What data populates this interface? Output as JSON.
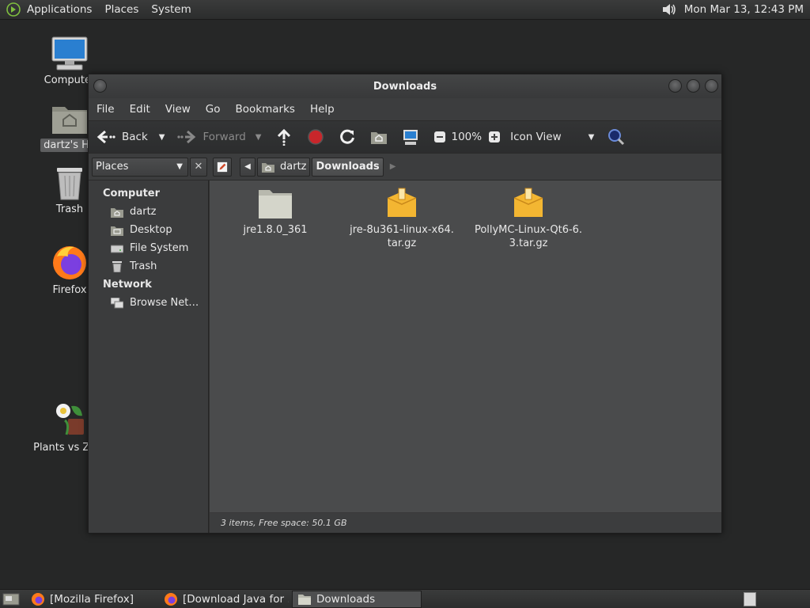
{
  "top_panel": {
    "menus": [
      "Applications",
      "Places",
      "System"
    ],
    "clock": "Mon Mar 13, 12:43 PM"
  },
  "desktop": {
    "icons": [
      {
        "label": "Computer",
        "icon": "computer-icon"
      },
      {
        "label": "dartz's Ho",
        "icon": "home-folder-icon"
      },
      {
        "label": "Trash",
        "icon": "trash-icon"
      },
      {
        "label": "Firefox",
        "icon": "firefox-icon"
      },
      {
        "label": "Plants vs Zom",
        "icon": "plants-vs-zombies-icon"
      }
    ]
  },
  "window": {
    "title": "Downloads",
    "menu": [
      "File",
      "Edit",
      "View",
      "Go",
      "Bookmarks",
      "Help"
    ],
    "toolbar": {
      "back": "Back",
      "forward": "Forward",
      "zoom": "100%",
      "view_mode": "Icon View"
    },
    "location": {
      "places_label": "Places",
      "crumbs": [
        "dartz",
        "Downloads"
      ]
    },
    "sidebar": {
      "sections": [
        {
          "heading": "Computer",
          "items": [
            {
              "label": "dartz",
              "icon": "home-icon"
            },
            {
              "label": "Desktop",
              "icon": "desktop-icon"
            },
            {
              "label": "File System",
              "icon": "drive-icon"
            },
            {
              "label": "Trash",
              "icon": "trash-icon"
            }
          ]
        },
        {
          "heading": "Network",
          "items": [
            {
              "label": "Browse Net…",
              "icon": "network-icon"
            }
          ]
        }
      ]
    },
    "files": [
      {
        "line1": "jre1.8.0_361",
        "line2": "",
        "type": "folder"
      },
      {
        "line1": "jre-8u361-linux-x64.",
        "line2": "tar.gz",
        "type": "archive"
      },
      {
        "line1": "PollyMC-Linux-Qt6-6.",
        "line2": "3.tar.gz",
        "type": "archive"
      }
    ],
    "status": "3 items, Free space: 50.1 GB"
  },
  "taskbar": {
    "tasks": [
      {
        "label": "[Mozilla Firefox]",
        "icon": "firefox-icon",
        "active": false
      },
      {
        "label": "[Download Java for …",
        "icon": "firefox-icon",
        "active": false
      },
      {
        "label": "Downloads",
        "icon": "folder-icon",
        "active": true
      }
    ]
  }
}
